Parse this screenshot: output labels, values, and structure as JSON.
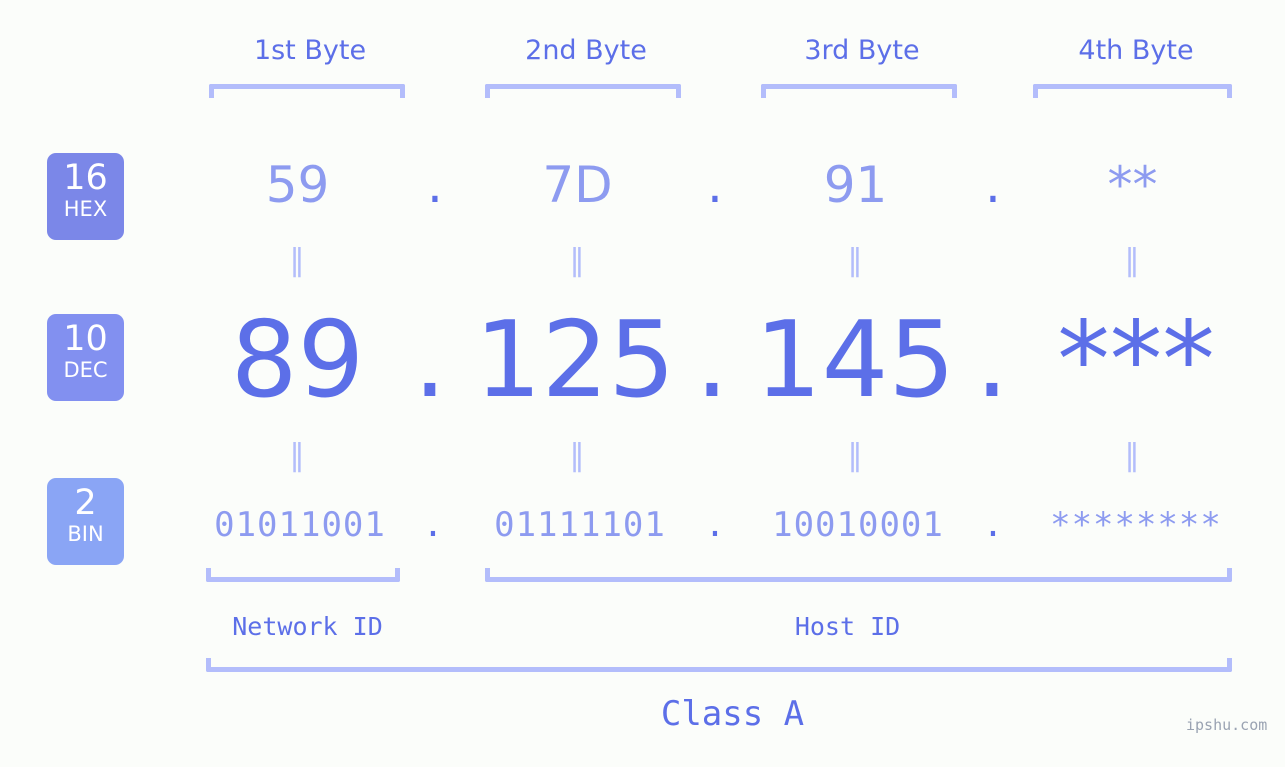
{
  "background_color": "#fbfdfa",
  "accent_color": "#5c6fe8",
  "accent_light_color": "#8d9bf0",
  "bracket_color": "#b3bdfb",
  "byte_headers": [
    {
      "label": "1st Byte"
    },
    {
      "label": "2nd Byte"
    },
    {
      "label": "3rd Byte"
    },
    {
      "label": "4th Byte"
    }
  ],
  "bases": [
    {
      "number": "16",
      "name": "HEX",
      "color": "#7b87e8"
    },
    {
      "number": "10",
      "name": "DEC",
      "color": "#8290f0"
    },
    {
      "number": "2",
      "name": "BIN",
      "color": "#8aa5f5"
    }
  ],
  "rows": {
    "hex": {
      "values": [
        "59",
        "7D",
        "91",
        "**"
      ],
      "separator": "."
    },
    "dec": {
      "values": [
        "89",
        "125",
        "145",
        "***"
      ],
      "separator": "."
    },
    "bin": {
      "values": [
        "01011001",
        "01111101",
        "10010001",
        "********"
      ],
      "separator": "."
    }
  },
  "equality_marker": "‖",
  "segments": {
    "network_id": "Network ID",
    "host_id": "Host ID"
  },
  "class_label": "Class A",
  "watermark": "ipshu.com"
}
